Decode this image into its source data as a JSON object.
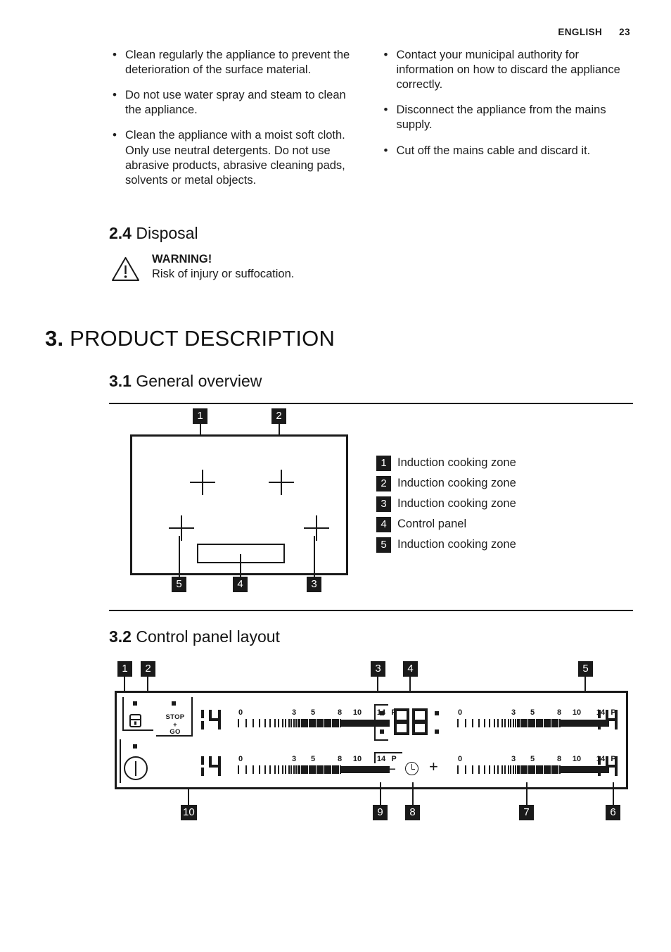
{
  "header": {
    "language": "ENGLISH",
    "page_number": "23"
  },
  "bullets": {
    "left": [
      "Clean regularly the appliance to prevent the deterioration of the surface material.",
      "Do not use water spray and steam to clean the appliance.",
      "Clean the appliance with a moist soft cloth. Only use neutral detergents. Do not use abrasive products, abrasive cleaning pads, solvents or metal objects."
    ],
    "right": [
      "Contact your municipal authority for information on how to discard the appliance correctly.",
      "Disconnect the appliance from the mains supply.",
      "Cut off the mains cable and discard it."
    ]
  },
  "disposal": {
    "number": "2.4",
    "title": "Disposal",
    "warning_label": "WARNING!",
    "warning_text": "Risk of injury or suffocation.",
    "icon": "warning-triangle-icon"
  },
  "chapter": {
    "number": "3.",
    "title": "PRODUCT DESCRIPTION"
  },
  "general_overview": {
    "number": "3.1",
    "title": "General overview",
    "callouts_top": [
      "1",
      "2"
    ],
    "callouts_bottom": [
      "5",
      "4",
      "3"
    ],
    "legend": [
      {
        "tag": "1",
        "label": "Induction cooking zone"
      },
      {
        "tag": "2",
        "label": "Induction cooking zone"
      },
      {
        "tag": "3",
        "label": "Induction cooking zone"
      },
      {
        "tag": "4",
        "label": "Control panel"
      },
      {
        "tag": "5",
        "label": "Induction cooking zone"
      }
    ]
  },
  "control_panel": {
    "number": "3.2",
    "title": "Control panel layout",
    "callouts_top": [
      "1",
      "2",
      "3",
      "4",
      "5"
    ],
    "callouts_bottom": [
      "10",
      "9",
      "8",
      "7",
      "6"
    ],
    "lock_icon": "lock-icon",
    "stop_go": {
      "line1": "STOP",
      "line2": "+",
      "line3": "GO"
    },
    "power_icon": "power-on-off-icon",
    "clock_icon": "timer-clock-icon",
    "minus_label": "—",
    "plus_label": "+",
    "timer_display": "88",
    "heat_displays": [
      "14",
      "14",
      "14",
      "14"
    ],
    "scale_labels": [
      "0",
      "3",
      "5",
      "8",
      "10",
      "14",
      "P"
    ]
  },
  "colors": {
    "ink": "#1a1a1a",
    "paper": "#ffffff",
    "tag_bg": "#1a1a1a",
    "tag_fg": "#ffffff"
  }
}
